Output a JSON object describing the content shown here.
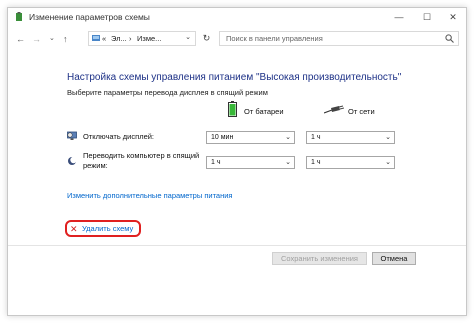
{
  "window": {
    "title": "Изменение параметров схемы",
    "controls": {
      "minimize": "—",
      "maximize": "☐",
      "close": "✕"
    }
  },
  "nav": {
    "back": "←",
    "forward": "→",
    "dropdown": "⌄",
    "up": "↑",
    "breadcrumb": [
      "«",
      "Эл...",
      "›",
      "Изме..."
    ],
    "search_placeholder": "Поиск в панели управления"
  },
  "main": {
    "heading": "Настройка схемы управления питанием \"Высокая производительность\"",
    "subheading": "Выберите параметры перевода дисплея в спящий режим",
    "columns": {
      "battery": "От батареи",
      "power": "От сети"
    },
    "settings": [
      {
        "label": "Отключать дисплей:",
        "battery": "10 мин",
        "power": "1 ч",
        "icon": "monitor-icon"
      },
      {
        "label_line1": "Переводить компьютер в спящий",
        "label_line2": "режим:",
        "battery": "1 ч",
        "power": "1 ч",
        "icon": "sleep-moon-icon"
      }
    ],
    "advanced_link": "Изменить дополнительные параметры питания",
    "delete_link": "Удалить схему",
    "highlight_color": "#e02020",
    "link_color": "#0066cc"
  },
  "footer": {
    "save_label": "Сохранить изменения",
    "cancel_label": "Отмена"
  }
}
